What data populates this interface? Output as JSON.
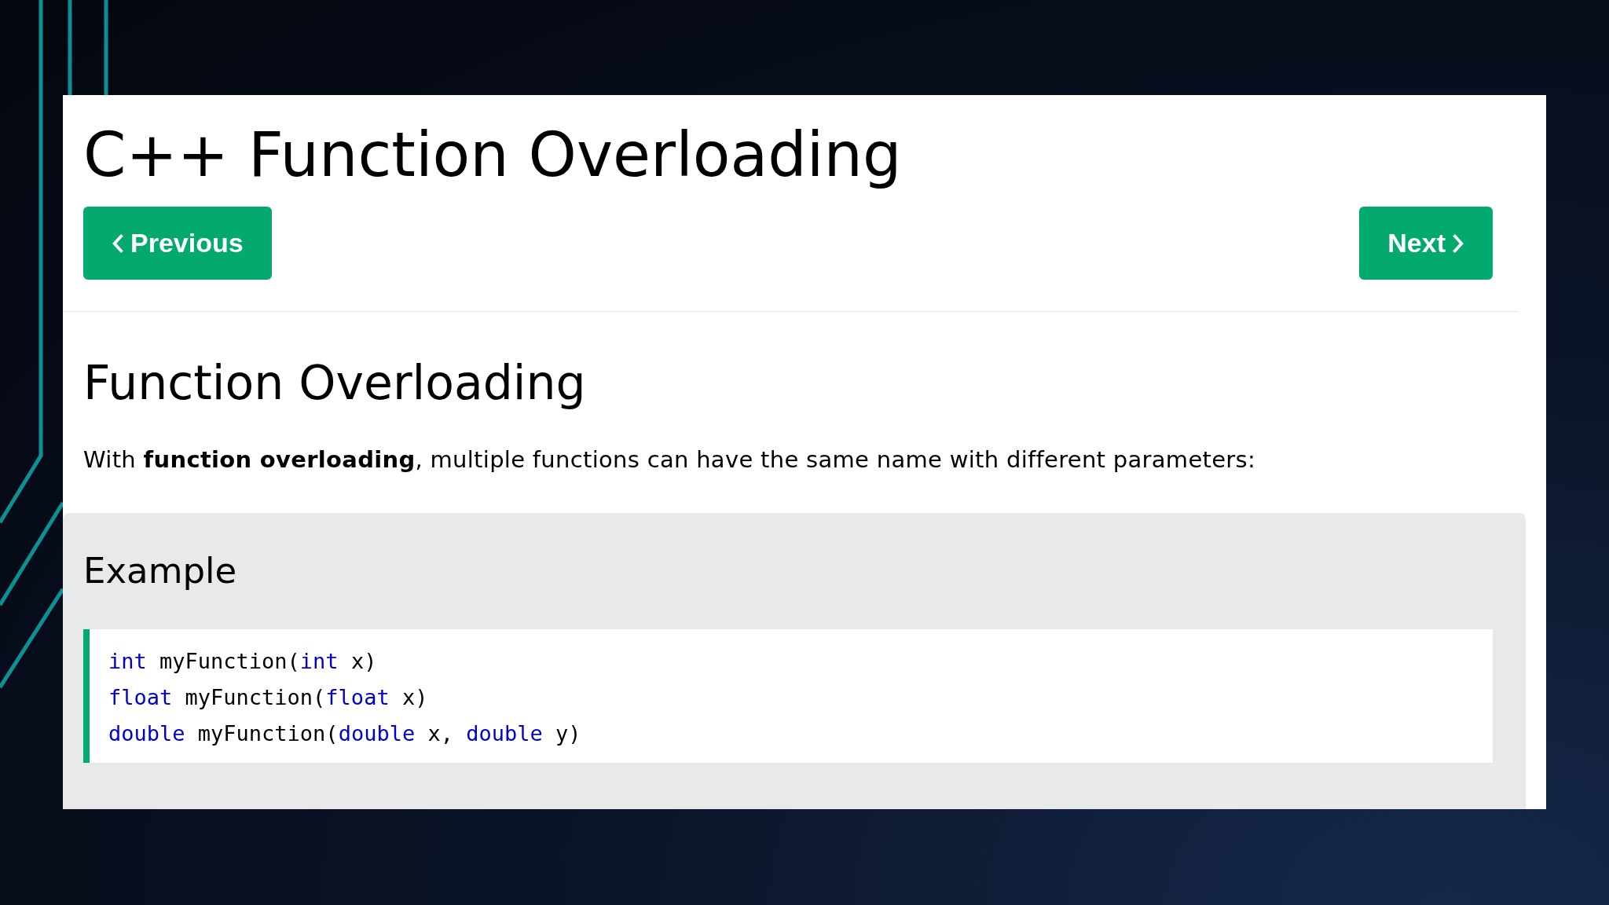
{
  "page": {
    "title": "C++ Function Overloading",
    "nav_buttons": [
      {
        "label": "Previous",
        "kind": "previous"
      },
      {
        "label": "Next",
        "kind": "next"
      }
    ],
    "heading": "Function Overloading",
    "paragraph": "With **function overloading**, multiple functions can have the same name with different parameters:",
    "example": {
      "heading": "Example",
      "code_lines": [
        [
          {
            "text": "int",
            "kind": "keyword"
          },
          {
            "text": " myFunction(",
            "kind": "plain"
          },
          {
            "text": "int",
            "kind": "keyword"
          },
          {
            "text": " x)",
            "kind": "plain"
          }
        ],
        [
          {
            "text": "float",
            "kind": "keyword"
          },
          {
            "text": " myFunction(",
            "kind": "plain"
          },
          {
            "text": "float",
            "kind": "keyword"
          },
          {
            "text": " x)",
            "kind": "plain"
          }
        ],
        [
          {
            "text": "double",
            "kind": "keyword"
          },
          {
            "text": " myFunction(",
            "kind": "plain"
          },
          {
            "text": "double",
            "kind": "keyword"
          },
          {
            "text": " x, ",
            "kind": "plain"
          },
          {
            "text": "double",
            "kind": "keyword"
          },
          {
            "text": " y)",
            "kind": "plain"
          }
        ]
      ]
    }
  }
}
